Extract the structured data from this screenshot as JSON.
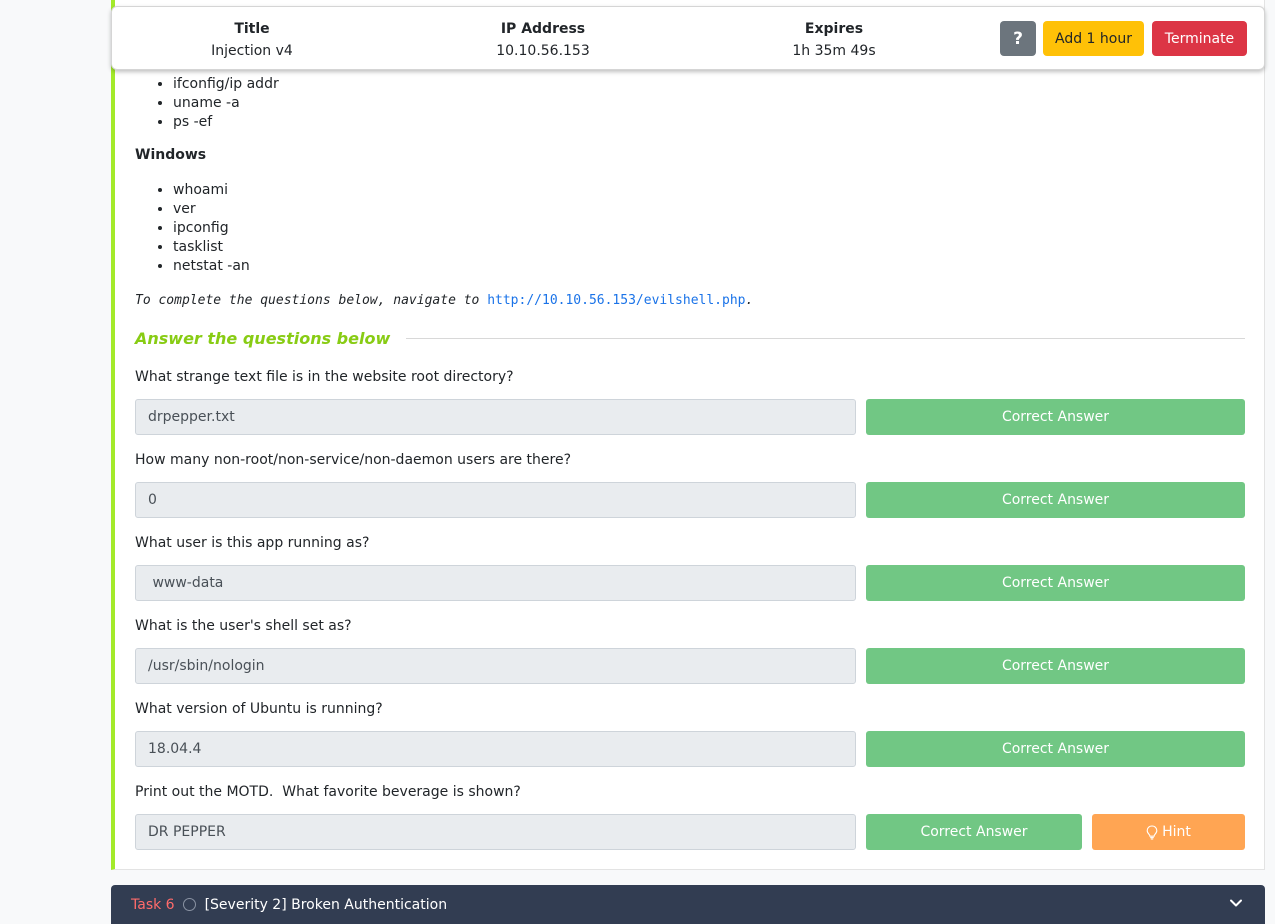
{
  "machine": {
    "title_header": "Title",
    "title_value": "Injection v4",
    "ip_header": "IP Address",
    "ip_value": "10.10.56.153",
    "expires_header": "Expires",
    "expires_value": "1h 35m 49s",
    "help_label": "?",
    "add_hour_label": "Add 1 hour",
    "terminate_label": "Terminate"
  },
  "linux_cmds": [
    "ifconfig/ip addr",
    "uname -a",
    "ps -ef"
  ],
  "windows": {
    "title": "Windows",
    "cmds": [
      "whoami",
      "ver",
      "ipconfig",
      "tasklist",
      "netstat -an"
    ]
  },
  "note": {
    "prefix": "To complete the questions below, navigate to ",
    "link": "http://10.10.56.153/evilshell.php",
    "suffix": "."
  },
  "answers_heading": "Answer the questions below",
  "questions": [
    {
      "q": "What strange text file is in the website root directory?",
      "a": "drpepper.txt",
      "btn": "Correct Answer"
    },
    {
      "q": "How many non-root/non-service/non-daemon users are there?",
      "a": "0",
      "btn": "Correct Answer"
    },
    {
      "q": "What user is this app running as?",
      "a": " www-data",
      "btn": "Correct Answer"
    },
    {
      "q": "What is the user's shell set as?",
      "a": "/usr/sbin/nologin",
      "btn": "Correct Answer"
    },
    {
      "q": "What version of Ubuntu is running?",
      "a": "18.04.4",
      "btn": "Correct Answer"
    },
    {
      "q": "Print out the MOTD.  What favorite beverage is shown?",
      "a": "DR PEPPER",
      "btn": "Correct Answer",
      "hint": "Hint"
    }
  ],
  "next_task": {
    "num": "Task 6",
    "title": "[Severity 2] Broken Authentication"
  },
  "colors": {
    "accent": "#88cc14",
    "correct": "#71c784",
    "hint": "#ffa553",
    "terminate": "#dc3545",
    "add_hour": "#ffc107",
    "taskbar": "#323d52"
  }
}
